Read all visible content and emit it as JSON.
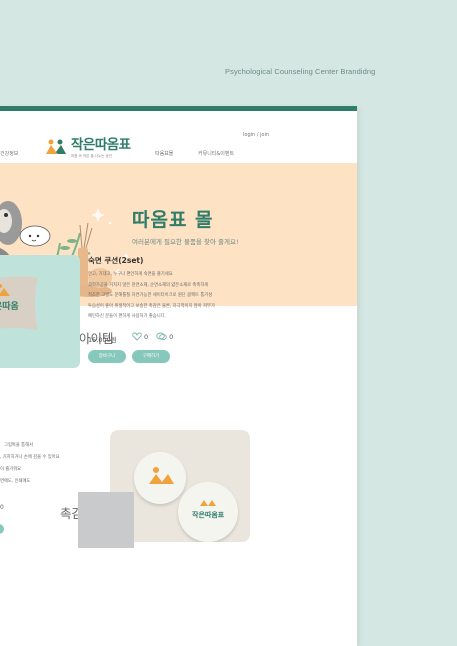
{
  "caption": "Psychological Counseling Center Brandidng",
  "header": {
    "nav_left": "건강정보",
    "logo_title": "작은따옴표",
    "logo_sub": "마음 속 작은 을 나누는 공간",
    "login": "login / join",
    "nav": [
      "따옴표몰",
      "커뮤니티&이벤트"
    ]
  },
  "hero": {
    "title": "따옴표 몰",
    "subtitle": "여러분에게 필요한 물품을 찾아 줄게요!"
  },
  "section1": {
    "title": "숙면아이템",
    "product_name": "숙면 쿠션(2set)",
    "desc": [
      "안고, 기대고, 누구나 편안하게 숙면을 즐기세요",
      "화학가공을 거치지 않은 천연소재, 순면소재의 얇은소재로 촉촉하게",
      "적조한 고밀도 문해틀칠 자연가능한 세이터이크로 원단 콤팩트 통기성",
      "투습성이 좋아 위생적이고 보송한 촉감은 물론, 자극적이지 않아 피부가",
      "예민하신 분들이 편하게 사용하기 좋습니다."
    ],
    "price": "15,000원",
    "likes": "0",
    "comments": "0",
    "btn_cart": "장바구니",
    "btn_buy": "구매하기"
  },
  "section2": {
    "title": "촉감 힐링",
    "desc": [
      "그립톡을 통해서",
      ", 거치하거나 손에 감을 수 있어요",
      "이 즐거워요",
      "면에도, 인쇄에도",
      "0"
    ],
    "griptok_text": "작은따옴표"
  },
  "colors": {
    "brand_green": "#2f7c68",
    "mint": "#86c8bc",
    "hero_peach": "#fde2c4",
    "background": "#d5e7e2"
  }
}
